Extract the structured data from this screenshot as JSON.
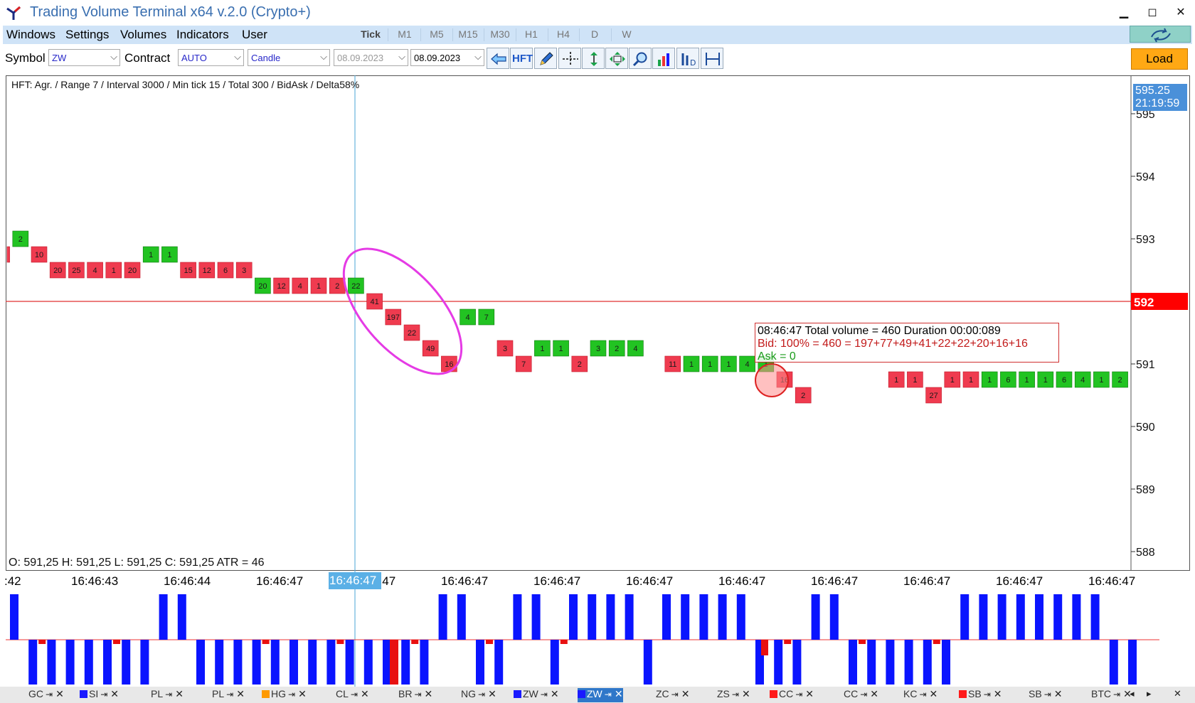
{
  "window": {
    "title": "Trading Volume Terminal x64 v.2.0 (Crypto+)"
  },
  "menu": [
    "Windows",
    "Settings",
    "Volumes",
    "Indicators",
    "User"
  ],
  "timeframes": [
    "Tick",
    "M1",
    "M5",
    "M15",
    "M30",
    "H1",
    "H4",
    "D",
    "W"
  ],
  "toolbar": {
    "symbol_label": "Symbol",
    "symbol_value": "ZW",
    "contract_label": "Contract",
    "contract_value": "AUTO",
    "chart_type": "Candle",
    "date_from": "08.09.2023",
    "date_to": "08.09.2023",
    "hft_label": "HFT",
    "load_label": "Load"
  },
  "chart": {
    "info": "HFT: Agr. / Range 7 / Interval 3000 / Min tick 15 / Total 300 / BidAsk / Delta58%",
    "ohlc": "O: 591,25  H: 591,25  L: 591,25  C: 591,25  ATR = 46",
    "current_price": "595.25",
    "current_time": "21:19:59",
    "marker_price": "592",
    "price_axis": [
      "595",
      "594",
      "593",
      "592",
      "591",
      "590",
      "589",
      "588"
    ],
    "time_axis": [
      ":42",
      "16:46:43",
      "16:46:44",
      "16:46:47",
      "16:46:47",
      "16:46:47",
      "16:46:47",
      "16:46:47",
      "16:46:47",
      "16:46:47",
      "16:46:47",
      "16:46:47",
      "16:46:47"
    ],
    "time_highlight": "16:46:47",
    "tooltip": {
      "line1": "08:46:47  Total volume = 460  Duration 00:00:089",
      "line2": "Bid:  100% = 460 =  197+77+49+41+22+22+20+16+16",
      "line3": "Ask = 0"
    },
    "colors": {
      "buy": "#22c322",
      "sell": "#ef3b4f",
      "annotation": "#e53be5",
      "delta_pos": "#0a14ff",
      "delta_neg": "#e81010",
      "price_line": "#e03030"
    }
  },
  "chart_data": {
    "type": "bar",
    "title": "",
    "series": [
      {
        "name": "sell",
        "cells": [
          [
            -2,
            592.75,
            ""
          ],
          [
            0,
            592.75,
            "10"
          ],
          [
            1,
            592.5,
            "20"
          ],
          [
            2,
            592.5,
            "25"
          ],
          [
            3,
            592.5,
            "4"
          ],
          [
            4,
            592.5,
            "1"
          ],
          [
            5,
            592.5,
            "20"
          ],
          [
            8,
            592.5,
            "15"
          ],
          [
            9,
            592.5,
            "12"
          ],
          [
            10,
            592.5,
            "6"
          ],
          [
            11,
            592.5,
            "3"
          ],
          [
            13,
            592.25,
            "12"
          ],
          [
            14,
            592.25,
            "4"
          ],
          [
            15,
            592.25,
            "1"
          ],
          [
            16,
            592.25,
            "2"
          ],
          [
            18,
            592,
            "41"
          ],
          [
            19,
            591.75,
            "197"
          ],
          [
            20,
            591.5,
            "22"
          ],
          [
            21,
            591.25,
            "49"
          ],
          [
            22,
            591,
            "16"
          ],
          [
            25,
            591.25,
            "3"
          ],
          [
            26,
            591,
            "7"
          ],
          [
            29,
            591,
            "2"
          ],
          [
            34,
            591,
            "11"
          ],
          [
            40,
            590.75,
            "16"
          ],
          [
            41,
            590.5,
            "2"
          ],
          [
            46,
            590.75,
            "1"
          ],
          [
            47,
            590.75,
            "1"
          ],
          [
            48,
            590.5,
            "27"
          ],
          [
            49,
            590.75,
            "1"
          ],
          [
            50,
            590.75,
            "1"
          ]
        ]
      },
      {
        "name": "buy",
        "cells": [
          [
            -1,
            593,
            "2"
          ],
          [
            6,
            592.75,
            "1"
          ],
          [
            7,
            592.75,
            "1"
          ],
          [
            12,
            592.25,
            "20"
          ],
          [
            17,
            592.25,
            "22"
          ],
          [
            23,
            591.75,
            "4"
          ],
          [
            24,
            591.75,
            "7"
          ],
          [
            27,
            591.25,
            "1"
          ],
          [
            28,
            591.25,
            "1"
          ],
          [
            30,
            591.25,
            "3"
          ],
          [
            31,
            591.25,
            "2"
          ],
          [
            32,
            591.25,
            "4"
          ],
          [
            35,
            591,
            "1"
          ],
          [
            36,
            591,
            "1"
          ],
          [
            37,
            591,
            "1"
          ],
          [
            38,
            591,
            "4"
          ],
          [
            39,
            591,
            "1"
          ],
          [
            51,
            590.75,
            "1"
          ],
          [
            52,
            590.75,
            "6"
          ],
          [
            53,
            590.75,
            "1"
          ],
          [
            54,
            590.75,
            "1"
          ],
          [
            55,
            590.75,
            "6"
          ],
          [
            56,
            590.75,
            "4"
          ],
          [
            57,
            590.75,
            "1"
          ],
          [
            58,
            590.75,
            "2"
          ],
          [
            59,
            590.75,
            "2"
          ]
        ]
      }
    ],
    "delta_bars": [
      1,
      -1,
      -1,
      -1,
      -1,
      -1,
      -1,
      -1,
      1,
      1,
      -1,
      -1,
      -1,
      -1,
      -1,
      -1,
      -1,
      -1,
      -1,
      -1,
      -1,
      -1,
      -1,
      1,
      1,
      -1,
      -1,
      1,
      1,
      -1,
      1,
      1,
      1,
      1,
      -1,
      1,
      1,
      1,
      1,
      1,
      -1,
      -1,
      -1,
      1,
      1,
      -1,
      -1,
      -1,
      -1,
      -1,
      -1,
      1,
      1,
      1,
      1,
      1,
      1,
      1,
      1,
      -1,
      -1
    ],
    "ylim": [
      587.75,
      595.25
    ],
    "ylabel": "",
    "xlabel": ""
  },
  "tabs": [
    {
      "label": "GC",
      "color": ""
    },
    {
      "label": "SI",
      "color": "#1a1aff"
    },
    {
      "label": "PL",
      "color": ""
    },
    {
      "label": "PL",
      "color": ""
    },
    {
      "label": "HG",
      "color": "#ff9a00"
    },
    {
      "label": "CL",
      "color": ""
    },
    {
      "label": "BR",
      "color": ""
    },
    {
      "label": "NG",
      "color": ""
    },
    {
      "label": "ZW",
      "color": "#1a1aff"
    },
    {
      "label": "ZW",
      "color": "#1a1aff",
      "active": true
    },
    {
      "label": "ZC",
      "color": ""
    },
    {
      "label": "ZS",
      "color": ""
    },
    {
      "label": "CC",
      "color": "#ff1a1a"
    },
    {
      "label": "CC",
      "color": ""
    },
    {
      "label": "KC",
      "color": ""
    },
    {
      "label": "SB",
      "color": "#ff1a1a"
    },
    {
      "label": "SB",
      "color": ""
    },
    {
      "label": "BTC",
      "color": ""
    }
  ]
}
